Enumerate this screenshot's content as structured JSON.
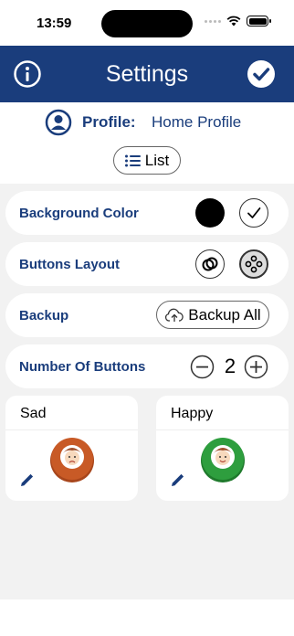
{
  "status_bar": {
    "time": "13:59"
  },
  "header": {
    "title": "Settings",
    "color": "#1a3d7c"
  },
  "profile": {
    "label": "Profile:",
    "value": "Home Profile"
  },
  "view_toggle": {
    "label": "List"
  },
  "settings": {
    "background_color": {
      "label": "Background Color",
      "selected_color": "#000000"
    },
    "buttons_layout": {
      "label": "Buttons Layout"
    },
    "backup": {
      "label": "Backup",
      "button_label": "Backup All"
    },
    "number_of_buttons": {
      "label": "Number Of Buttons",
      "value": "2"
    }
  },
  "buttons": [
    {
      "title": "Sad",
      "color": "#c85a26"
    },
    {
      "title": "Happy",
      "color": "#2e9e3e"
    }
  ]
}
